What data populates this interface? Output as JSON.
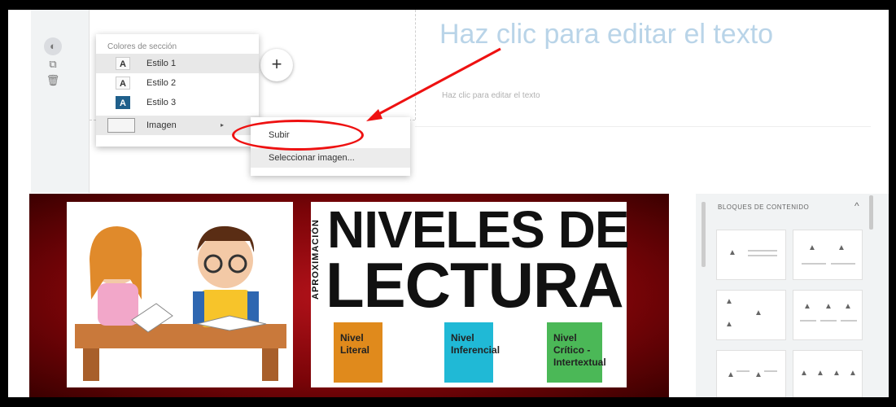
{
  "toolbar": {
    "palette_icon": "palette-icon",
    "copy_icon": "copy-icon",
    "trash_icon": "trash-icon"
  },
  "section_menu": {
    "title": "Colores de sección",
    "items": [
      {
        "swatch": "A",
        "label": "Estilo 1"
      },
      {
        "swatch": "A",
        "label": "Estilo 2"
      },
      {
        "swatch": "A",
        "label": "Estilo 3"
      },
      {
        "label": "Imagen",
        "caret": "▸"
      }
    ]
  },
  "image_submenu": {
    "items": [
      "Subir",
      "Seleccionar imagen..."
    ]
  },
  "add_button": {
    "label": "+"
  },
  "section": {
    "heading": "Haz clic para editar el texto",
    "subtext": "Haz clic para editar el texto"
  },
  "banner": {
    "side_text": "APROXIMACIÓN",
    "title_line1": "NIVELES DE",
    "title_line2": "LECTURA",
    "tags": [
      "Nivel Literal",
      "Nivel Inferencial",
      "Nivel Crítico - Intertextual"
    ]
  },
  "content_blocks": {
    "title": "BLOQUES DE CONTENIDO",
    "caret": "^"
  },
  "colors": {
    "highlight": "#e11111",
    "banner_red": "#b3121a"
  }
}
